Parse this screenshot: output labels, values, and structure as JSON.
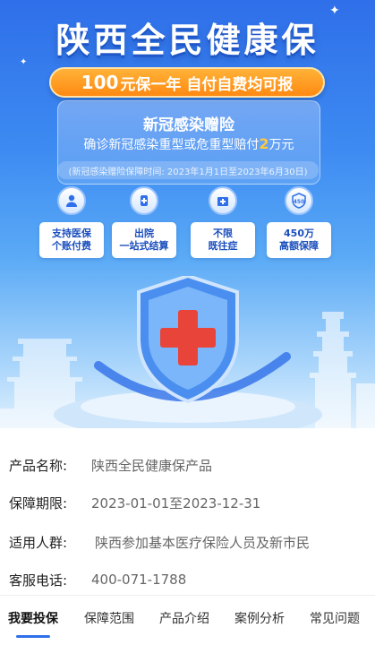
{
  "banner": {
    "title": "陕西全民健康保",
    "orange_bar": {
      "highlight": "100",
      "rest": "元保一年 自付自费均可报"
    },
    "panel": {
      "title": "新冠感染赠险",
      "sub_prefix": "确诊新冠感染重型或危重型赔付",
      "sub_highlight": "2",
      "sub_suffix": "万元",
      "period": "(新冠感染赠险保障时间: 2023年1月1日至2023年6月30日)"
    },
    "features": [
      {
        "icon": "person-icon",
        "glyph": "👤",
        "line1": "支持医保",
        "line2": "个账付费"
      },
      {
        "icon": "medicine-icon",
        "glyph": "💊",
        "line1": "出院",
        "line2": "一站式结算"
      },
      {
        "icon": "hospital-icon",
        "glyph": "✚",
        "line1": "不限",
        "line2": "既往症"
      },
      {
        "icon": "shield-badge-icon",
        "glyph": "450",
        "line1": "450万",
        "line2": "高额保障"
      }
    ],
    "colors": {
      "primary": "#2f6fe9",
      "orange": "#ff8a12",
      "highlight": "#ffc93d",
      "cross": "#e8443a"
    }
  },
  "info": {
    "product_label": "产品名称:",
    "product_value": "陕西全民健康保产品",
    "period_label": "保障期限:",
    "period_value": "2023-01-01至2023-12-31",
    "audience_label": "适用人群:",
    "audience_value": "陕西参加基本医疗保险人员及新市民",
    "phone_label": "客服电话:",
    "phone_value": "400-071-1788"
  },
  "tabs": [
    {
      "label": "我要投保",
      "active": true
    },
    {
      "label": "保障范围",
      "active": false
    },
    {
      "label": "产品介绍",
      "active": false
    },
    {
      "label": "案例分析",
      "active": false
    },
    {
      "label": "常见问题",
      "active": false
    }
  ]
}
